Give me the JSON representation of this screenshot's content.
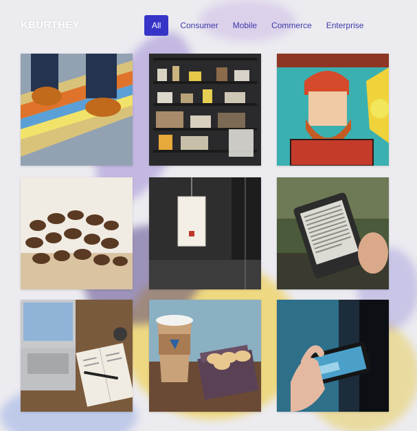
{
  "brand": {
    "logo_text": "KBURTHEY"
  },
  "nav": {
    "items": [
      {
        "label": "All",
        "active": true
      },
      {
        "label": "Consumer",
        "active": false
      },
      {
        "label": "Mobile",
        "active": false
      },
      {
        "label": "Commerce",
        "active": false
      },
      {
        "label": "Enterprise",
        "active": false
      }
    ]
  },
  "colors": {
    "accent": "#3634c7",
    "nav_text": "#3b39a8",
    "background": "#ecebf0"
  },
  "gallery": [
    {
      "subject": "skateboard-shoes"
    },
    {
      "subject": "bookshelf"
    },
    {
      "subject": "bearded-man-mural"
    },
    {
      "subject": "coffee-beans"
    },
    {
      "subject": "paper-lantern"
    },
    {
      "subject": "e-reader"
    },
    {
      "subject": "laptop-notebook-desk"
    },
    {
      "subject": "coffee-cup-cookies"
    },
    {
      "subject": "phone-in-hand"
    }
  ]
}
